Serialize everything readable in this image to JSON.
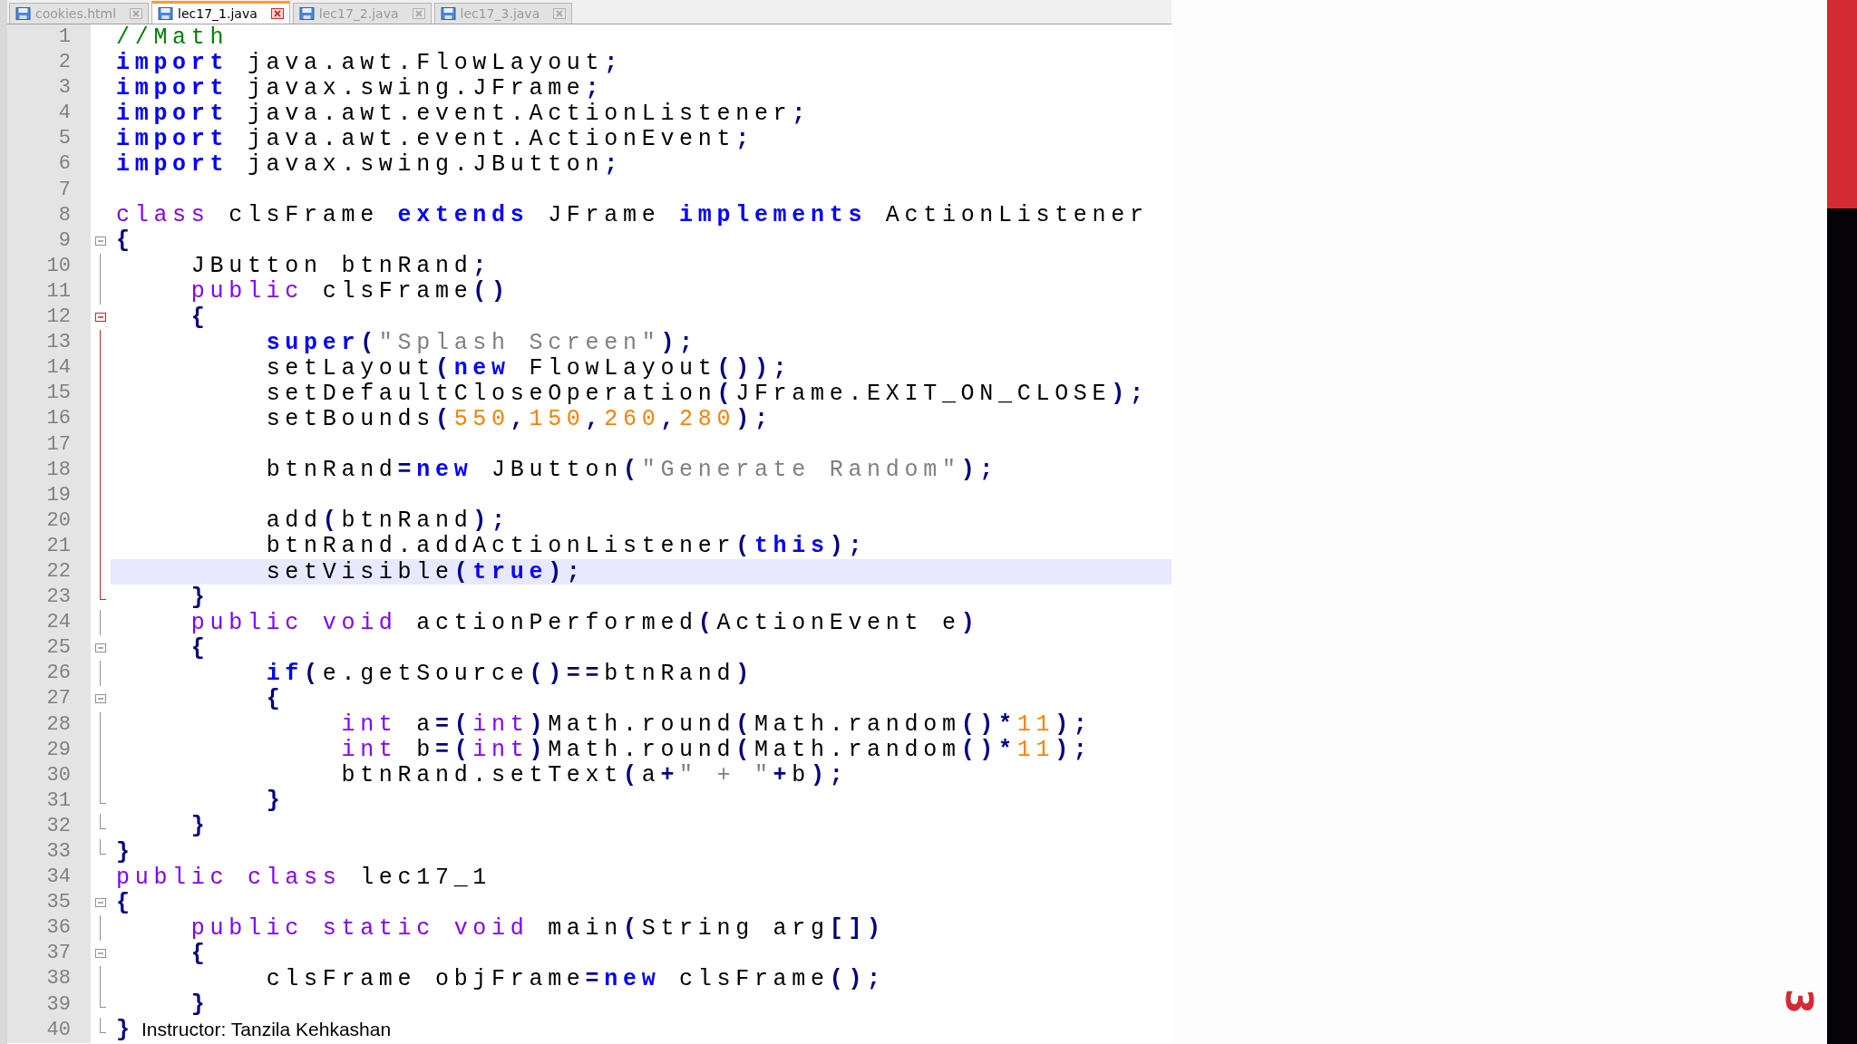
{
  "tabs": [
    {
      "label": "cookies.html",
      "selected": false
    },
    {
      "label": "lec17_1.java",
      "selected": true
    },
    {
      "label": "lec17_2.java",
      "selected": false
    },
    {
      "label": "lec17_3.java",
      "selected": false
    }
  ],
  "lines": [
    {
      "number": "1",
      "tokens": [
        {
          "kind": "comment",
          "text": "//Math"
        }
      ]
    },
    {
      "number": "2",
      "tokens": [
        {
          "kind": "keyword",
          "text": "import"
        },
        {
          "kind": "plain",
          "text": " java.awt.FlowLayout"
        },
        {
          "kind": "op",
          "text": ";"
        }
      ]
    },
    {
      "number": "3",
      "tokens": [
        {
          "kind": "keyword",
          "text": "import"
        },
        {
          "kind": "plain",
          "text": " javax.swing.JFrame"
        },
        {
          "kind": "op",
          "text": ";"
        }
      ]
    },
    {
      "number": "4",
      "tokens": [
        {
          "kind": "keyword",
          "text": "import"
        },
        {
          "kind": "plain",
          "text": " java.awt.event.ActionListener"
        },
        {
          "kind": "op",
          "text": ";"
        }
      ]
    },
    {
      "number": "5",
      "tokens": [
        {
          "kind": "keyword",
          "text": "import"
        },
        {
          "kind": "plain",
          "text": " java.awt.event.ActionEvent"
        },
        {
          "kind": "op",
          "text": ";"
        }
      ]
    },
    {
      "number": "6",
      "tokens": [
        {
          "kind": "keyword",
          "text": "import"
        },
        {
          "kind": "plain",
          "text": " javax.swing.JButton"
        },
        {
          "kind": "op",
          "text": ";"
        }
      ]
    },
    {
      "number": "7"
    },
    {
      "number": "8",
      "tokens": [
        {
          "kind": "type",
          "text": "class"
        },
        {
          "kind": "plain",
          "text": " clsFrame "
        },
        {
          "kind": "keyword",
          "text": "extends"
        },
        {
          "kind": "plain",
          "text": " JFrame "
        },
        {
          "kind": "keyword",
          "text": "implements"
        },
        {
          "kind": "plain",
          "text": " ActionListener"
        }
      ]
    },
    {
      "number": "9",
      "fold_start": true,
      "tokens": [
        {
          "kind": "op",
          "text": "{"
        }
      ]
    },
    {
      "number": "10",
      "fold_line": true,
      "tokens": [
        {
          "kind": "plain",
          "text": "    JButton btnRand"
        },
        {
          "kind": "op",
          "text": ";"
        }
      ]
    },
    {
      "number": "11",
      "fold_line": true,
      "tokens": [
        {
          "kind": "type",
          "text": "    public"
        },
        {
          "kind": "plain",
          "text": " clsFrame"
        },
        {
          "kind": "op",
          "text": "()"
        }
      ]
    },
    {
      "number": "12",
      "fold_start": true,
      "red": true,
      "tokens": [
        {
          "kind": "op",
          "text": "    {"
        }
      ]
    },
    {
      "number": "13",
      "fold_line": true,
      "red": true,
      "tokens": [
        {
          "kind": "keyword",
          "text": "        super"
        },
        {
          "kind": "op",
          "text": "("
        },
        {
          "kind": "string",
          "text": "\"Splash Screen\""
        },
        {
          "kind": "op",
          "text": ");"
        }
      ]
    },
    {
      "number": "14",
      "fold_line": true,
      "red": true,
      "tokens": [
        {
          "kind": "plain",
          "text": "        setLayout"
        },
        {
          "kind": "op",
          "text": "("
        },
        {
          "kind": "keyword",
          "text": "new"
        },
        {
          "kind": "plain",
          "text": " FlowLayout"
        },
        {
          "kind": "op",
          "text": "());"
        }
      ]
    },
    {
      "number": "15",
      "fold_line": true,
      "red": true,
      "tokens": [
        {
          "kind": "plain",
          "text": "        setDefaultCloseOperation"
        },
        {
          "kind": "op",
          "text": "("
        },
        {
          "kind": "plain",
          "text": "JFrame.EXIT_ON_CLOSE"
        },
        {
          "kind": "op",
          "text": ");"
        }
      ]
    },
    {
      "number": "16",
      "fold_line": true,
      "red": true,
      "tokens": [
        {
          "kind": "plain",
          "text": "        setBounds"
        },
        {
          "kind": "op",
          "text": "("
        },
        {
          "kind": "number",
          "text": "550"
        },
        {
          "kind": "op",
          "text": ","
        },
        {
          "kind": "number",
          "text": "150"
        },
        {
          "kind": "op",
          "text": ","
        },
        {
          "kind": "number",
          "text": "260"
        },
        {
          "kind": "op",
          "text": ","
        },
        {
          "kind": "number",
          "text": "280"
        },
        {
          "kind": "op",
          "text": ");"
        }
      ]
    },
    {
      "number": "17",
      "fold_line": true,
      "red": true
    },
    {
      "number": "18",
      "fold_line": true,
      "red": true,
      "tokens": [
        {
          "kind": "plain",
          "text": "        btnRand"
        },
        {
          "kind": "op",
          "text": "="
        },
        {
          "kind": "keyword",
          "text": "new"
        },
        {
          "kind": "plain",
          "text": " JButton"
        },
        {
          "kind": "op",
          "text": "("
        },
        {
          "kind": "string",
          "text": "\"Generate Random\""
        },
        {
          "kind": "op",
          "text": ");"
        }
      ]
    },
    {
      "number": "19",
      "fold_line": true,
      "red": true
    },
    {
      "number": "20",
      "fold_line": true,
      "red": true,
      "tokens": [
        {
          "kind": "plain",
          "text": "        add"
        },
        {
          "kind": "op",
          "text": "("
        },
        {
          "kind": "plain",
          "text": "btnRand"
        },
        {
          "kind": "op",
          "text": ");"
        }
      ]
    },
    {
      "number": "21",
      "fold_line": true,
      "red": true,
      "tokens": [
        {
          "kind": "plain",
          "text": "        btnRand.addActionListener"
        },
        {
          "kind": "op",
          "text": "("
        },
        {
          "kind": "keyword",
          "text": "this"
        },
        {
          "kind": "op",
          "text": ");"
        }
      ]
    },
    {
      "number": "22",
      "fold_line": true,
      "red": true,
      "current": true,
      "tokens": [
        {
          "kind": "plain",
          "text": "        setVisible"
        },
        {
          "kind": "op",
          "text": "("
        },
        {
          "kind": "keyword",
          "text": "true"
        },
        {
          "kind": "op",
          "text": ");"
        }
      ]
    },
    {
      "number": "23",
      "fold_end": true,
      "red": true,
      "tokens": [
        {
          "kind": "op",
          "text": "    }"
        }
      ]
    },
    {
      "number": "24",
      "fold_line": true,
      "tokens": [
        {
          "kind": "type",
          "text": "    public void"
        },
        {
          "kind": "plain",
          "text": " actionPerformed"
        },
        {
          "kind": "op",
          "text": "("
        },
        {
          "kind": "plain",
          "text": "ActionEvent e"
        },
        {
          "kind": "op",
          "text": ")"
        }
      ]
    },
    {
      "number": "25",
      "fold_start": true,
      "tokens": [
        {
          "kind": "op",
          "text": "    {"
        }
      ]
    },
    {
      "number": "26",
      "fold_line": true,
      "tokens": [
        {
          "kind": "keyword",
          "text": "        if"
        },
        {
          "kind": "op",
          "text": "("
        },
        {
          "kind": "plain",
          "text": "e.getSource"
        },
        {
          "kind": "op",
          "text": "()=="
        },
        {
          "kind": "plain",
          "text": "btnRand"
        },
        {
          "kind": "op",
          "text": ")"
        }
      ]
    },
    {
      "number": "27",
      "fold_start": true,
      "tokens": [
        {
          "kind": "op",
          "text": "        {"
        }
      ]
    },
    {
      "number": "28",
      "fold_line": true,
      "tokens": [
        {
          "kind": "type",
          "text": "            int"
        },
        {
          "kind": "plain",
          "text": " a"
        },
        {
          "kind": "op",
          "text": "=("
        },
        {
          "kind": "type",
          "text": "int"
        },
        {
          "kind": "op",
          "text": ")"
        },
        {
          "kind": "plain",
          "text": "Math.round"
        },
        {
          "kind": "op",
          "text": "("
        },
        {
          "kind": "plain",
          "text": "Math.random"
        },
        {
          "kind": "op",
          "text": "()*"
        },
        {
          "kind": "number",
          "text": "11"
        },
        {
          "kind": "op",
          "text": ");"
        }
      ]
    },
    {
      "number": "29",
      "fold_line": true,
      "tokens": [
        {
          "kind": "type",
          "text": "            int"
        },
        {
          "kind": "plain",
          "text": " b"
        },
        {
          "kind": "op",
          "text": "=("
        },
        {
          "kind": "type",
          "text": "int"
        },
        {
          "kind": "op",
          "text": ")"
        },
        {
          "kind": "plain",
          "text": "Math.round"
        },
        {
          "kind": "op",
          "text": "("
        },
        {
          "kind": "plain",
          "text": "Math.random"
        },
        {
          "kind": "op",
          "text": "()*"
        },
        {
          "kind": "number",
          "text": "11"
        },
        {
          "kind": "op",
          "text": ");"
        }
      ]
    },
    {
      "number": "30",
      "fold_line": true,
      "tokens": [
        {
          "kind": "plain",
          "text": "            btnRand.setText"
        },
        {
          "kind": "op",
          "text": "("
        },
        {
          "kind": "plain",
          "text": "a"
        },
        {
          "kind": "op",
          "text": "+"
        },
        {
          "kind": "string",
          "text": "\" + \""
        },
        {
          "kind": "op",
          "text": "+"
        },
        {
          "kind": "plain",
          "text": "b"
        },
        {
          "kind": "op",
          "text": ");"
        }
      ]
    },
    {
      "number": "31",
      "fold_end": true,
      "tokens": [
        {
          "kind": "op",
          "text": "        }"
        }
      ]
    },
    {
      "number": "32",
      "fold_end": true,
      "tokens": [
        {
          "kind": "op",
          "text": "    }"
        }
      ]
    },
    {
      "number": "33",
      "fold_end": true,
      "tokens": [
        {
          "kind": "op",
          "text": "}"
        }
      ]
    },
    {
      "number": "34",
      "tokens": [
        {
          "kind": "type",
          "text": "public class"
        },
        {
          "kind": "plain",
          "text": " lec17_1"
        }
      ]
    },
    {
      "number": "35",
      "fold_start": true,
      "tokens": [
        {
          "kind": "op",
          "text": "{"
        }
      ]
    },
    {
      "number": "36",
      "fold_line": true,
      "tokens": [
        {
          "kind": "type",
          "text": "    public static void"
        },
        {
          "kind": "plain",
          "text": " main"
        },
        {
          "kind": "op",
          "text": "("
        },
        {
          "kind": "plain",
          "text": "String arg"
        },
        {
          "kind": "op",
          "text": "[])"
        }
      ]
    },
    {
      "number": "37",
      "fold_start": true,
      "tokens": [
        {
          "kind": "op",
          "text": "    {"
        }
      ]
    },
    {
      "number": "38",
      "fold_line": true,
      "tokens": [
        {
          "kind": "plain",
          "text": "        clsFrame objFrame"
        },
        {
          "kind": "op",
          "text": "="
        },
        {
          "kind": "keyword",
          "text": "new"
        },
        {
          "kind": "plain",
          "text": " clsFrame"
        },
        {
          "kind": "op",
          "text": "();"
        }
      ]
    },
    {
      "number": "39",
      "fold_end": true,
      "tokens": [
        {
          "kind": "op",
          "text": "    }"
        }
      ]
    },
    {
      "number": "40",
      "fold_end": true,
      "tokens": [
        {
          "kind": "op",
          "text": "}"
        }
      ]
    }
  ],
  "footer": "Instructor: Tanzila Kehkashan",
  "slide_number": "3"
}
